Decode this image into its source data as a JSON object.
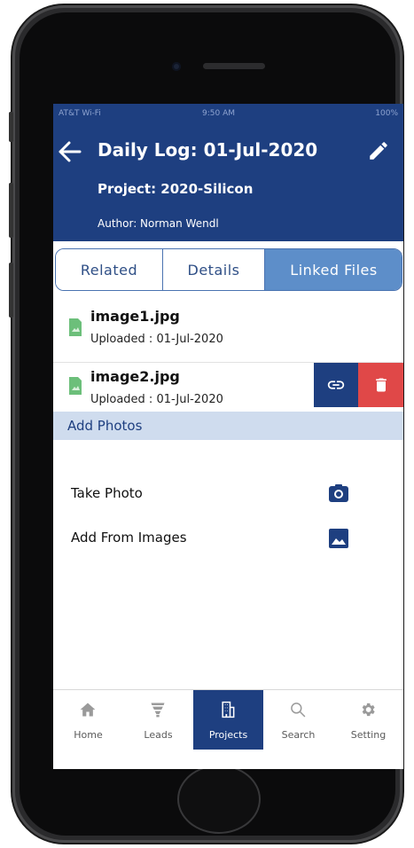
{
  "status_bar": {
    "carrier": "AT&T Wi-Fi",
    "time": "9:50 AM",
    "battery": "100%"
  },
  "header": {
    "title": "Daily Log: 01-Jul-2020",
    "project": "Project: 2020-Silicon",
    "author": "Author: Norman Wendl"
  },
  "tabs": [
    {
      "label": "Related"
    },
    {
      "label": "Details"
    },
    {
      "label": "Linked Files"
    }
  ],
  "files": [
    {
      "name": "image1.jpg",
      "uploaded": "Uploaded : 01-Jul-2020"
    },
    {
      "name": "image2.jpg",
      "uploaded": "Uploaded : 01-Jul-2020"
    }
  ],
  "add_photos": {
    "section_title": "Add Photos",
    "take_photo": "Take Photo",
    "add_from_images": "Add From Images"
  },
  "bottom_nav": [
    {
      "label": "Home",
      "icon": "home-icon"
    },
    {
      "label": "Leads",
      "icon": "funnel-icon"
    },
    {
      "label": "Projects",
      "icon": "building-icon"
    },
    {
      "label": "Search",
      "icon": "search-icon"
    },
    {
      "label": "Setting",
      "icon": "gear-icon"
    }
  ],
  "colors": {
    "primary": "#1e3f80",
    "active_tab": "#5d8ec9",
    "section_bg": "#cfdcee",
    "delete": "#e04848",
    "file_icon": "#6cbf7a"
  }
}
